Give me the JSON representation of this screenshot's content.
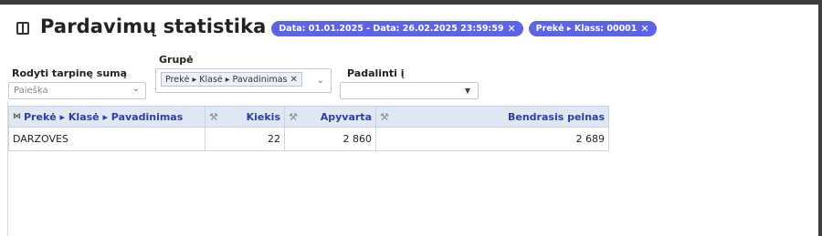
{
  "page": {
    "title": "Pardavimų statistika",
    "filters": [
      {
        "label": "Data: 01.01.2025 - Data: 26.02.2025 23:59:59",
        "remove": "✕"
      },
      {
        "label": "Prekė ▸ Klass: 00001",
        "remove": "✕"
      }
    ]
  },
  "controls": {
    "subtotal": {
      "label": "Rodyti tarpinę sumą",
      "placeholder": "Paieška",
      "chevron": "⌄"
    },
    "group": {
      "label": "Grupė",
      "tag": "Prekė ▸ Klasė ▸ Pavadinimas",
      "tag_remove": "✕",
      "chevron": "⌄"
    },
    "split": {
      "label": "Padalinti į",
      "value": "",
      "arrow": "▼"
    }
  },
  "table": {
    "columns": [
      {
        "label": "Prekė ▸ Klasė ▸ Pavadinimas",
        "icon": "pin-icon"
      },
      {
        "label": "Kiekis",
        "icon": "wrench-icon"
      },
      {
        "label": "Apyvarta",
        "icon": "wrench-icon"
      },
      {
        "label": "Bendrasis pelnas",
        "icon": "wrench-icon"
      }
    ],
    "rows": [
      {
        "name": "DARZOVES",
        "qty": "22",
        "turnover": "2 860",
        "profit": "2 689"
      }
    ]
  },
  "colors": {
    "chip": "#5b63e6",
    "header_bg": "#dfe7f4",
    "header_text": "#2c3fa0"
  }
}
